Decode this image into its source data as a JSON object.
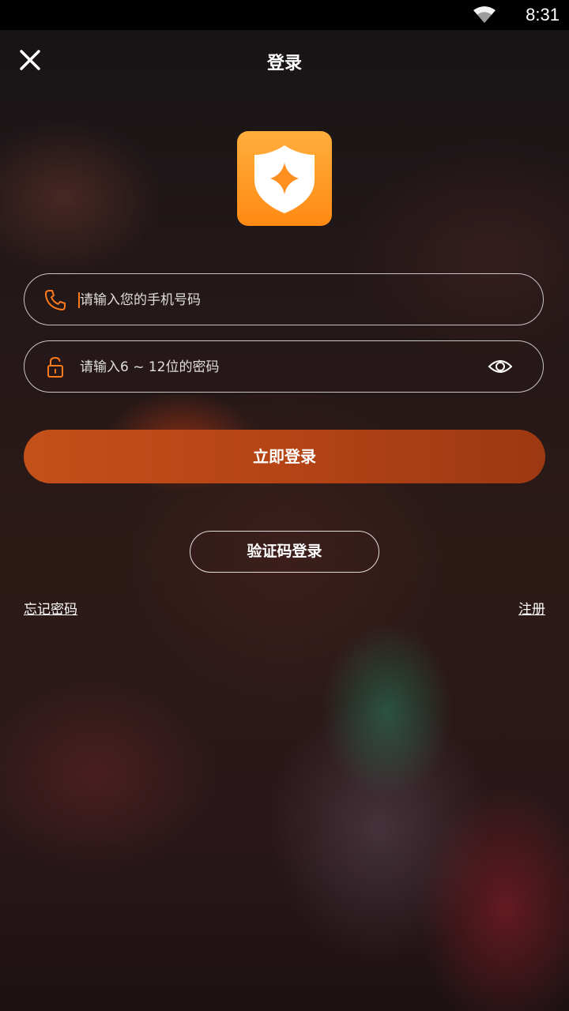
{
  "status_bar": {
    "time": "8:31",
    "wifi_icon": "wifi-icon"
  },
  "header": {
    "title": "登录",
    "close_icon": "close-icon"
  },
  "logo": {
    "icon": "shield-star-icon",
    "colors": [
      "#ffae3c",
      "#ff8a14"
    ]
  },
  "form": {
    "phone": {
      "icon": "phone-icon",
      "placeholder": "请输入您的手机号码",
      "value": ""
    },
    "password": {
      "icon": "unlock-icon",
      "placeholder": "请输入6 ~ 12位的密码",
      "value": "",
      "toggle_icon": "eye-icon"
    },
    "login_button": "立即登录",
    "code_login_button": "验证码登录"
  },
  "links": {
    "forgot_password": "忘记密码",
    "register": "注册"
  },
  "colors": {
    "accent": "#ff7a1a",
    "button": "#b54415",
    "logo": "#ff9a28"
  }
}
